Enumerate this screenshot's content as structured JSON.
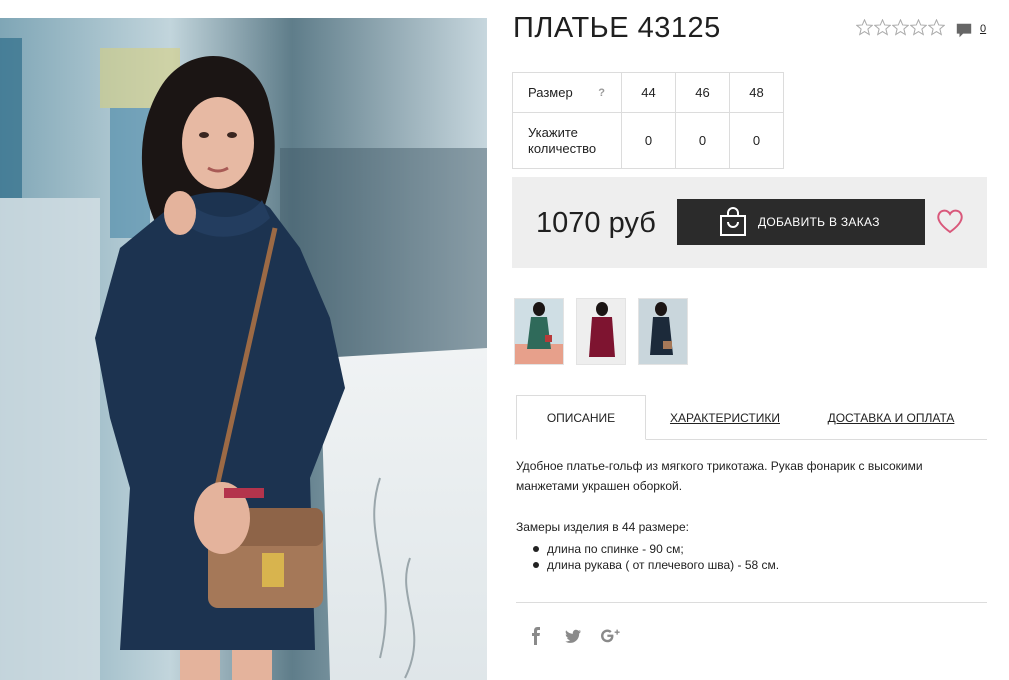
{
  "product": {
    "title": "ПЛАТЬЕ 43125",
    "rating_stars": 5,
    "rating_value": 0,
    "comments_count": "0"
  },
  "sizes": {
    "size_label": "Размер",
    "help_mark": "?",
    "quantity_label": "Укажите количество",
    "items": [
      {
        "size": "44",
        "qty": "0"
      },
      {
        "size": "46",
        "qty": "0"
      },
      {
        "size": "48",
        "qty": "0"
      }
    ]
  },
  "price": {
    "amount": "1070 руб",
    "order_button": "ДОБАВИТЬ В ЗАКАЗ"
  },
  "thumbnails": [
    "green-dress-thumb",
    "burgundy-dress-thumb",
    "navy-dress-thumb"
  ],
  "tabs": [
    {
      "label": "ОПИСАНИЕ",
      "active": true
    },
    {
      "label": "ХАРАКТЕРИСТИКИ",
      "active": false
    },
    {
      "label": "ДОСТАВКА И ОПЛАТА",
      "active": false
    }
  ],
  "description": {
    "text": "Удобное платье-гольф из мягкого трикотажа. Рукав фонарик с высокими манжетами украшен оборкой.",
    "measure_title": "Замеры изделия в 44 размере:",
    "measures": [
      "длина по спинке - 90 см;",
      "длина рукава ( от плечевого шва) - 58 см."
    ]
  },
  "social": [
    "facebook-icon",
    "twitter-icon",
    "google-plus-icon"
  ],
  "colors": {
    "accent_heart": "#d9587b",
    "button_bg": "#2b2b2b",
    "price_bg": "#eeeeee"
  }
}
